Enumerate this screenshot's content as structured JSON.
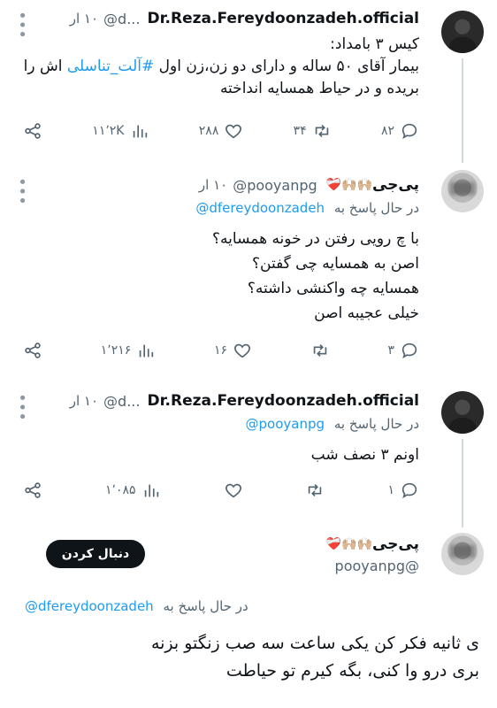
{
  "tweets": [
    {
      "name": "Dr.Reza.Fereydoonzadeh.official",
      "handle": "@d...",
      "time": "۱۰ ار",
      "lines": [
        "کیس ۳ بامداد:",
        "بیمار آقای ۵۰ ساله و دارای دو زن،زن اول",
        "#آلت_تناسلی",
        "اش را",
        "بریده و در حیاط همسایه انداخته"
      ],
      "stats": {
        "replies": "۸۲",
        "retweets": "۳۴",
        "likes": "۲۸۸",
        "views": "۱۱٬۲K"
      }
    },
    {
      "name": "پی‌جی",
      "handle": "@pooyanpg",
      "time": "۱۰ ار",
      "reply_label": "در حال پاسخ به",
      "reply_to": "@dfereydoonzadeh",
      "lines": [
        "با چ رویی رفتن در خونه همسایه؟",
        "اصن به همسایه چی گفتن؟",
        "همسایه چه واکنشی داشته؟",
        "خیلی عجیبه اصن"
      ],
      "stats": {
        "replies": "۳",
        "retweets": "",
        "likes": "۱۶",
        "views": "۱٬۲۱۶"
      }
    },
    {
      "name": "Dr.Reza.Fereydoonzadeh.official",
      "handle": "@d...",
      "time": "۱۰ ار",
      "reply_label": "در حال پاسخ به",
      "reply_to": "@pooyanpg",
      "lines": [
        "اونم ۳ نصف شب"
      ],
      "stats": {
        "replies": "۱",
        "retweets": "",
        "likes": "",
        "views": "۱٬۰۸۵"
      }
    },
    {
      "name": "پی‌جی",
      "handle": "@pooyanpg",
      "follow_label": "دنبال کردن",
      "reply_label": "در حال پاسخ به",
      "reply_to": "@dfereydoonzadeh",
      "lines": [
        "ی ثانیه فکر کن یکی ساعت سه صب زنگتو بزنه",
        "بری درو وا کنی، بگه کیرم تو حیاطت"
      ]
    }
  ],
  "icons": {
    "reply": "reply-icon",
    "retweet": "retweet-icon",
    "like": "heart-icon",
    "views": "views-icon",
    "share": "share-icon",
    "more": "more-icon",
    "emoji_name": "🙌🏼🙌🏼❤️‍🩹"
  },
  "colors": {
    "accent": "#1d9bf0",
    "text": "#0f1419",
    "muted": "#536471"
  }
}
